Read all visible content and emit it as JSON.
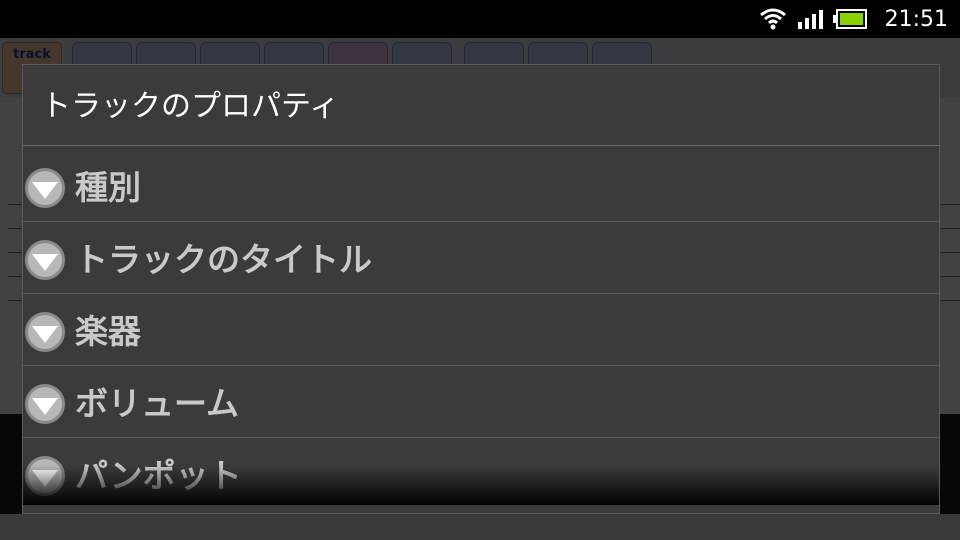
{
  "status_bar": {
    "time": "21:51",
    "icons": [
      "wifi-icon",
      "signal-icon",
      "battery-icon"
    ],
    "battery_color": "#8bd000"
  },
  "background": {
    "track_button_label": "track",
    "toolbar_color": "#b5c4e8"
  },
  "dialog": {
    "title": "トラックのプロパティ",
    "items": [
      {
        "label": "種別",
        "icon": "chevron-down-icon"
      },
      {
        "label": "トラックのタイトル",
        "icon": "chevron-down-icon"
      },
      {
        "label": "楽器",
        "icon": "chevron-down-icon"
      },
      {
        "label": "ボリューム",
        "icon": "chevron-down-icon"
      },
      {
        "label": "パンポット",
        "icon": "chevron-down-icon"
      }
    ]
  }
}
